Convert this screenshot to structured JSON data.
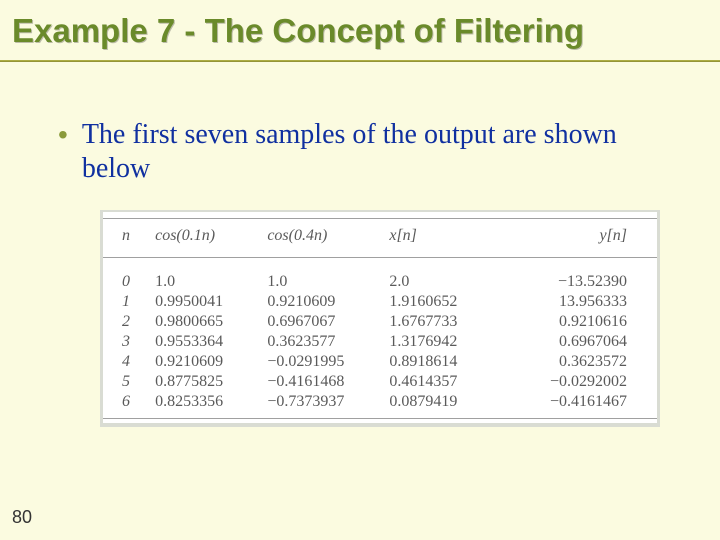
{
  "title": "Example 7 - The Concept of Filtering",
  "bullet": "The first seven samples of the output are shown below",
  "page_number": "80",
  "chart_data": {
    "type": "table",
    "title": "",
    "columns": [
      "n",
      "cos(0.1n)",
      "cos(0.4n)",
      "x[n]",
      "y[n]"
    ],
    "rows": [
      [
        "0",
        "1.0",
        "1.0",
        "2.0",
        "−13.52390"
      ],
      [
        "1",
        "0.9950041",
        "0.9210609",
        "1.9160652",
        "13.956333"
      ],
      [
        "2",
        "0.9800665",
        "0.6967067",
        "1.6767733",
        "0.9210616"
      ],
      [
        "3",
        "0.9553364",
        "0.3623577",
        "1.3176942",
        "0.6967064"
      ],
      [
        "4",
        "0.9210609",
        "−0.0291995",
        "0.8918614",
        "0.3623572"
      ],
      [
        "5",
        "0.8775825",
        "−0.4161468",
        "0.4614357",
        "−0.0292002"
      ],
      [
        "6",
        "0.8253356",
        "−0.7373937",
        "0.0879419",
        "−0.4161467"
      ]
    ]
  }
}
